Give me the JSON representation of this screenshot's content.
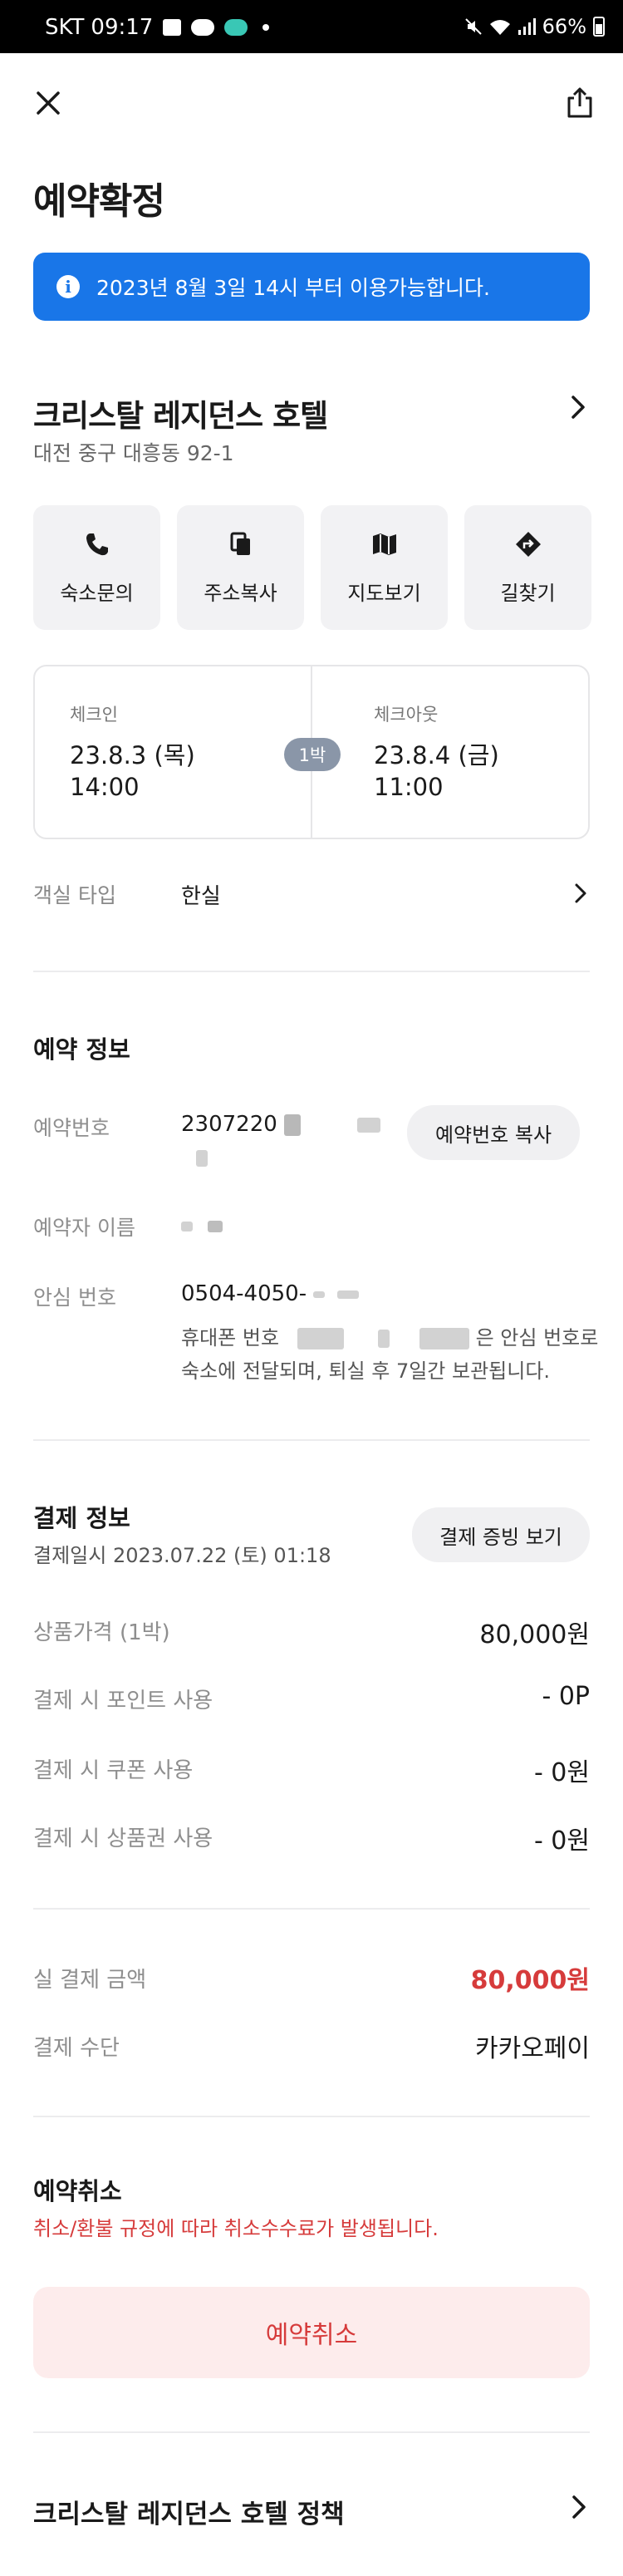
{
  "status_bar": {
    "carrier": "SKT",
    "time": "09:17",
    "battery": "66%"
  },
  "page": {
    "title": "예약확정"
  },
  "notice": {
    "text": "2023년 8월 3일 14시 부터 이용가능합니다."
  },
  "hotel": {
    "name": "크리스탈 레지던스 호텔",
    "address": "대전 중구 대흥동 92-1",
    "actions": [
      {
        "label": "숙소문의",
        "icon": "phone-icon"
      },
      {
        "label": "주소복사",
        "icon": "copy-icon"
      },
      {
        "label": "지도보기",
        "icon": "map-icon"
      },
      {
        "label": "길찾기",
        "icon": "directions-icon"
      }
    ]
  },
  "stay": {
    "checkin_label": "체크인",
    "checkin_date": "23.8.3 (목)",
    "checkin_time": "14:00",
    "nights": "1박",
    "checkout_label": "체크아웃",
    "checkout_date": "23.8.4 (금)",
    "checkout_time": "11:00",
    "room_type_label": "객실 타입",
    "room_type": "한실"
  },
  "reservation": {
    "section_title": "예약 정보",
    "number_label": "예약번호",
    "number_value": "2307220",
    "copy_button": "예약번호 복사",
    "name_label": "예약자 이름",
    "safe_label": "안심 번호",
    "safe_value": "0504-4050-",
    "safe_note_prefix": "휴대폰 번호",
    "safe_note_suffix": "은 안심 번호로",
    "safe_note_line2": "숙소에 전달되며, 퇴실 후 7일간 보관됩니다."
  },
  "payment": {
    "section_title": "결제 정보",
    "date": "결제일시 2023.07.22 (토) 01:18",
    "receipt_button": "결제 증빙 보기",
    "rows": [
      {
        "label": "상품가격 (1박)",
        "value": "80,000원"
      },
      {
        "label": "결제 시 포인트 사용",
        "value": "- 0P"
      },
      {
        "label": "결제 시 쿠폰 사용",
        "value": "- 0원"
      },
      {
        "label": "결제 시 상품권 사용",
        "value": "- 0원"
      }
    ],
    "total_label": "실 결제 금액",
    "total_value": "80,000원",
    "method_label": "결제 수단",
    "method_value": "카카오페이",
    "accent_color": "#d63b3b"
  },
  "cancel": {
    "title": "예약취소",
    "description": "취소/환불 규정에 따라 취소수수료가 발생됩니다.",
    "button": "예약취소"
  },
  "policy": {
    "title": "크리스탈 레지던스 호텔 정책"
  }
}
